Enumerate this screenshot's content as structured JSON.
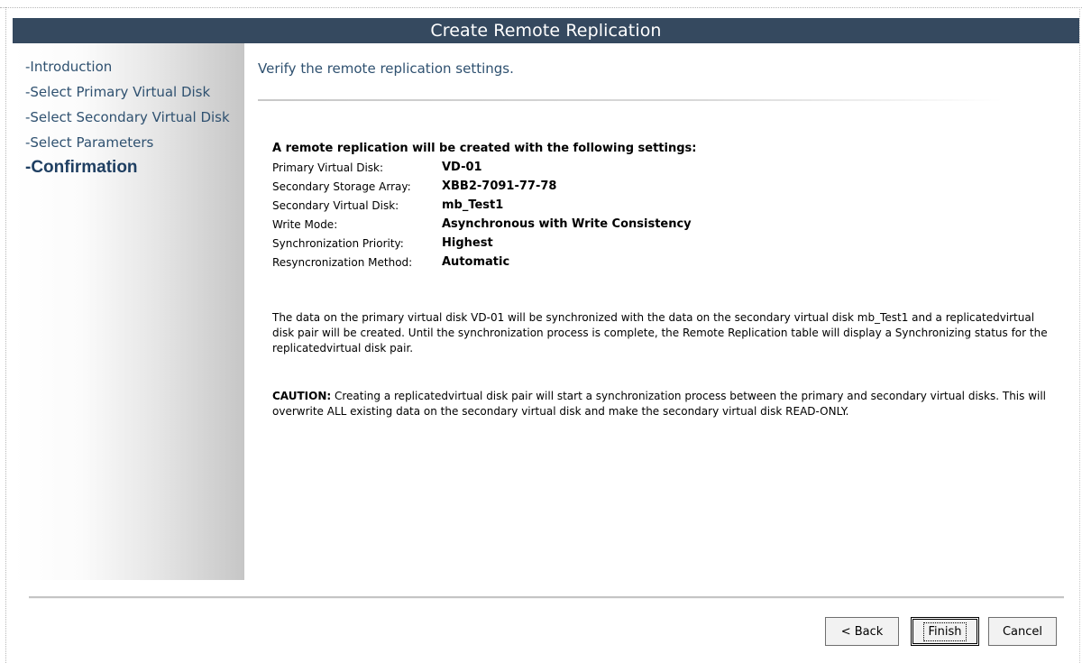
{
  "dialog": {
    "title": "Create Remote Replication"
  },
  "sidebar": {
    "steps": [
      {
        "label": "-Introduction",
        "active": false
      },
      {
        "label": "-Select Primary Virtual Disk",
        "active": false
      },
      {
        "label": "-Select Secondary Virtual Disk",
        "active": false
      },
      {
        "label": "-Select Parameters",
        "active": false
      },
      {
        "label": "-Confirmation",
        "active": true
      }
    ]
  },
  "content": {
    "instruction": "Verify the remote replication settings.",
    "summary_heading": "A remote replication will be created with the following settings:",
    "settings": [
      {
        "label": "Primary Virtual Disk:",
        "value": "VD-01"
      },
      {
        "label": "Secondary Storage Array:",
        "value": "XBB2-7091-77-78"
      },
      {
        "label": "Secondary Virtual Disk:",
        "value": "mb_Test1"
      },
      {
        "label": "Write Mode:",
        "value": "Asynchronous with Write Consistency"
      },
      {
        "label": "Synchronization Priority:",
        "value": "Highest"
      },
      {
        "label": "Resyncronization Method:",
        "value": "Automatic"
      }
    ],
    "description": "The data on the primary virtual disk VD-01 will be synchronized with the data on the secondary virtual disk mb_Test1 and a replicatedvirtual disk pair will be created. Until the synchronization process is complete, the Remote Replication table will display a Synchronizing status for the replicatedvirtual disk pair.",
    "caution_label": "CAUTION:",
    "caution_text": " Creating a replicatedvirtual disk pair will start a synchronization process between the primary and secondary virtual disks. This will overwrite ALL existing data on the secondary virtual disk and make the secondary virtual disk READ-ONLY."
  },
  "buttons": {
    "back": "< Back",
    "finish": "Finish",
    "cancel": "Cancel"
  }
}
